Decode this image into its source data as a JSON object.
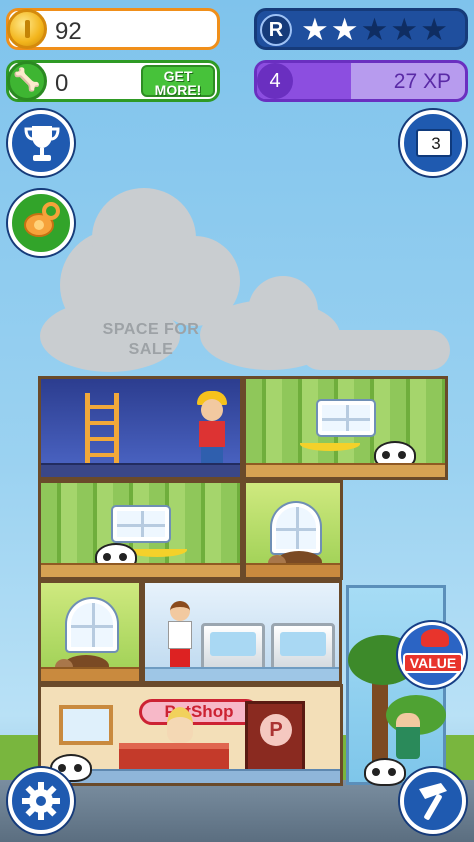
{
  "hud": {
    "coins": "92",
    "bones": "0",
    "get_more_label": "GET MORE!",
    "rank_letter": "R",
    "rank_stars": {
      "filled": 2,
      "total": 5
    },
    "level": "4",
    "xp_label": "27 XP",
    "xp_fraction": 0.45,
    "book_count": "3"
  },
  "cloud": {
    "text": "SPACE FOR SALE"
  },
  "shop": {
    "sign": "PetShop",
    "door_letter": "P"
  },
  "badges": {
    "value_label": "VALUE"
  },
  "colors": {
    "coin_border": "#f08f1a",
    "bone_border": "#2f9a25",
    "rank_bg": "#1f4f9e",
    "xp_bg": "#8c4ee0",
    "sky": "#9bd2f1"
  },
  "icons": {
    "coin": "coin-icon",
    "bone": "bone-icon",
    "trophy": "trophy-icon",
    "pacifier": "pacifier-icon",
    "book": "book-icon",
    "gear": "gear-icon",
    "hammer": "hammer-icon",
    "gift_bow": "gift-bow-icon",
    "star": "star-icon"
  }
}
